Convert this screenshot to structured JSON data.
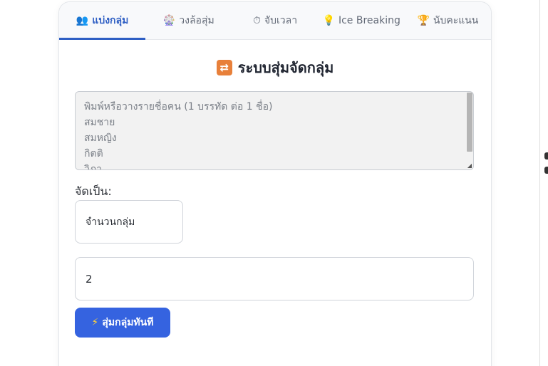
{
  "tabs": [
    {
      "icon": "👥",
      "label": "แบ่งกลุ่ม",
      "active": true
    },
    {
      "icon": "🎡",
      "label": "วงล้อสุ่ม",
      "active": false
    },
    {
      "icon": "⏱",
      "label": "จับเวลา",
      "active": false
    },
    {
      "icon": "💡",
      "label": "Ice Breaking",
      "active": false
    },
    {
      "icon": "🏆",
      "label": "นับคะแนน",
      "active": false
    }
  ],
  "header": {
    "icon": "🔀",
    "title": "ระบบสุ่มจัดกลุ่ม"
  },
  "names": {
    "placeholder": "พิมพ์หรือวางรายชื่อคน (1 บรรทัด ต่อ 1 ชื่อ)",
    "lines": [
      "สมชาย",
      "สมหญิง",
      "กิตติ",
      "วิภา"
    ]
  },
  "split": {
    "label": "จัดเป็น:",
    "mode": "จำนวนกลุ่ม",
    "count": "2"
  },
  "action": {
    "icon": "⚡",
    "label": "สุ่มกลุ่มทันที"
  }
}
